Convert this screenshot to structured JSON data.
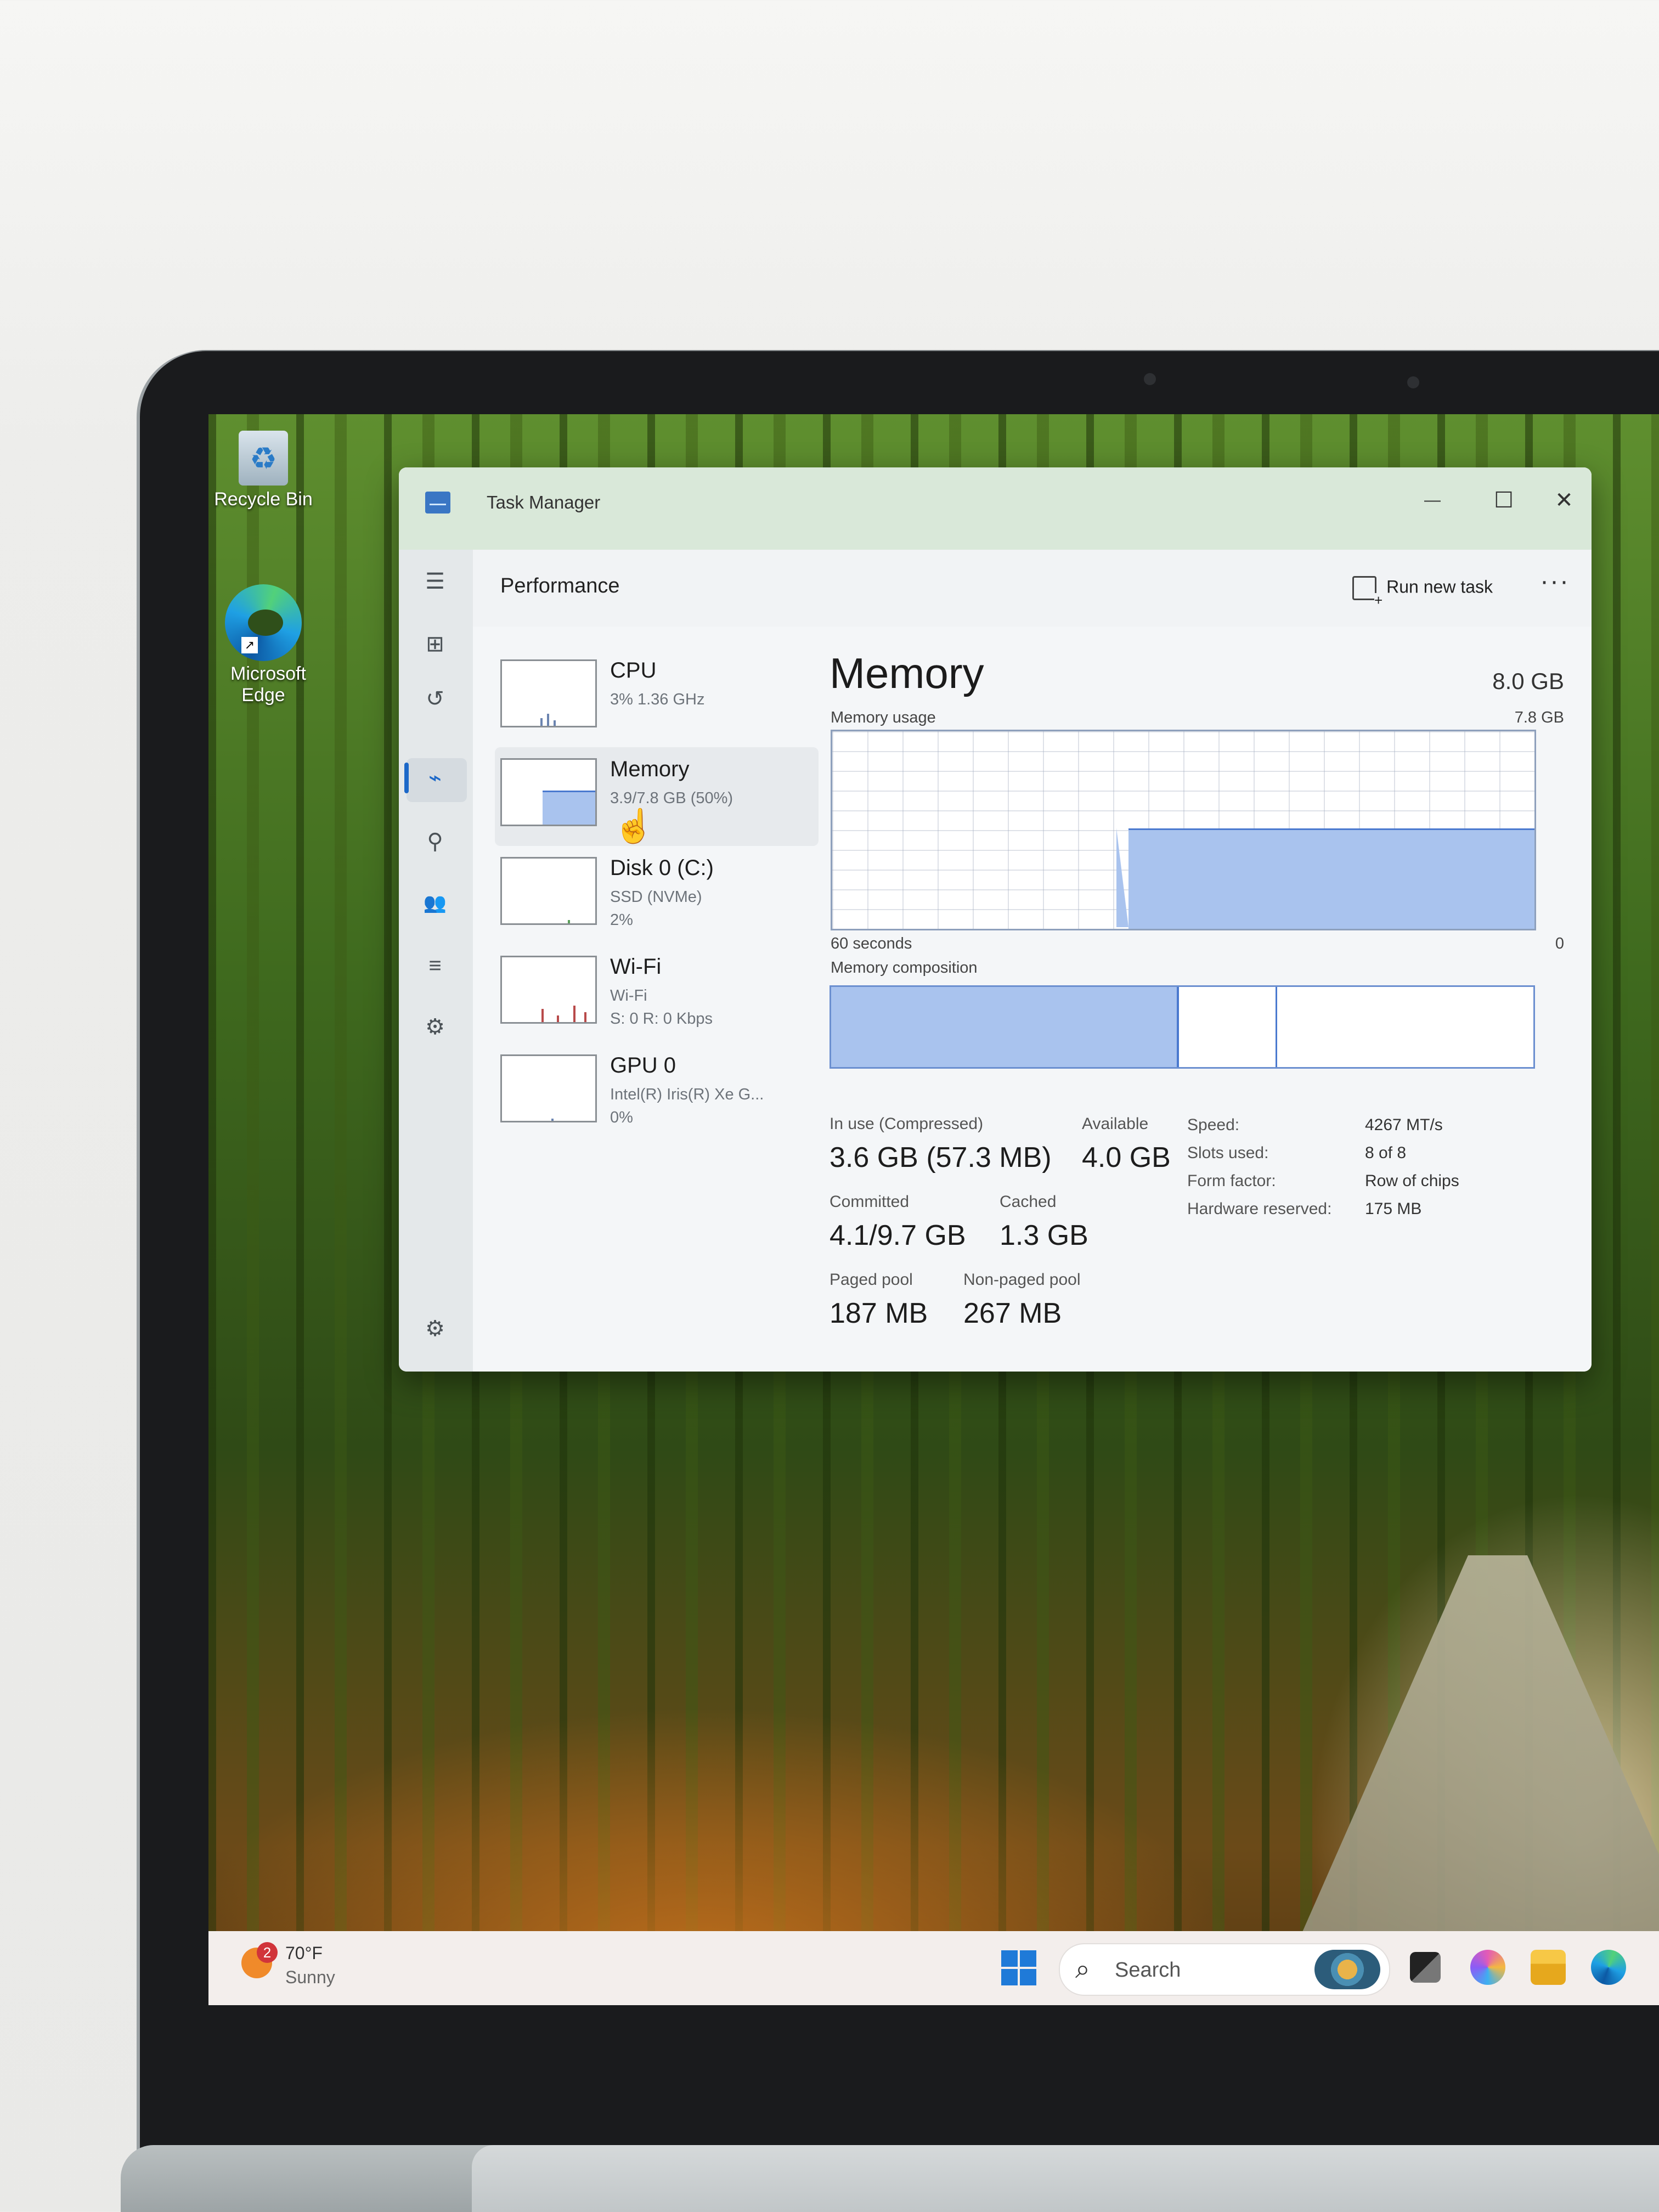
{
  "desktop": {
    "icons": [
      {
        "label": "Recycle Bin",
        "icon": "recycle-bin-icon"
      },
      {
        "label": "Microsoft Edge",
        "icon": "edge-icon"
      }
    ]
  },
  "window": {
    "title": "Task Manager",
    "controls": {
      "minimize": "—",
      "maximize": "☐",
      "close": "✕"
    }
  },
  "header": {
    "section_title": "Performance",
    "run_new_task": "Run new task",
    "more": "···"
  },
  "nav": [
    {
      "name": "hamburger-menu-icon",
      "glyph": "☰"
    },
    {
      "name": "processes-icon",
      "glyph": "⊞"
    },
    {
      "name": "performance-icon",
      "glyph": "⌁"
    },
    {
      "name": "app-history-icon",
      "glyph": "↺"
    },
    {
      "name": "startup-apps-icon",
      "glyph": "⚲"
    },
    {
      "name": "users-icon",
      "glyph": "👥"
    },
    {
      "name": "details-icon",
      "glyph": "≡"
    },
    {
      "name": "services-icon",
      "glyph": "⚙"
    },
    {
      "name": "settings-icon",
      "glyph": "⚙"
    }
  ],
  "resources": [
    {
      "name": "CPU",
      "sub": "3% 1.36 GHz"
    },
    {
      "name": "Memory",
      "sub": "3.9/7.8 GB (50%)"
    },
    {
      "name": "Disk 0 (C:)",
      "sub": "SSD (NVMe)\n2%"
    },
    {
      "name": "Wi-Fi",
      "sub": "Wi-Fi\nS: 0 R: 0 Kbps"
    },
    {
      "name": "GPU 0",
      "sub": "Intel(R) Iris(R) Xe G...\n0%"
    }
  ],
  "memory": {
    "title": "Memory",
    "total": "8.0 GB",
    "usage_label": "Memory usage",
    "usage_max": "7.8 GB",
    "usage_fraction": 0.5,
    "time_span": "60 seconds",
    "time_end": "0",
    "composition_label": "Memory composition",
    "stats": {
      "in_use_label": "In use (Compressed)",
      "in_use_value": "3.6 GB (57.3 MB)",
      "available_label": "Available",
      "available_value": "4.0 GB",
      "committed_label": "Committed",
      "committed_value": "4.1/9.7 GB",
      "cached_label": "Cached",
      "cached_value": "1.3 GB",
      "paged_label": "Paged pool",
      "paged_value": "187 MB",
      "nonpaged_label": "Non-paged pool",
      "nonpaged_value": "267 MB"
    },
    "details": [
      {
        "key": "Speed:",
        "value": "4267 MT/s"
      },
      {
        "key": "Slots used:",
        "value": "8 of 8"
      },
      {
        "key": "Form factor:",
        "value": "Row of chips"
      },
      {
        "key": "Hardware reserved:",
        "value": "175 MB"
      }
    ]
  },
  "taskbar": {
    "weather_badge": "2",
    "weather_temp": "70°F",
    "weather_condition": "Sunny",
    "search_placeholder": "Search"
  },
  "colors": {
    "accent": "#1c68c8",
    "memory_fill": "#a9c3ee",
    "memory_line": "#4a79cf"
  }
}
